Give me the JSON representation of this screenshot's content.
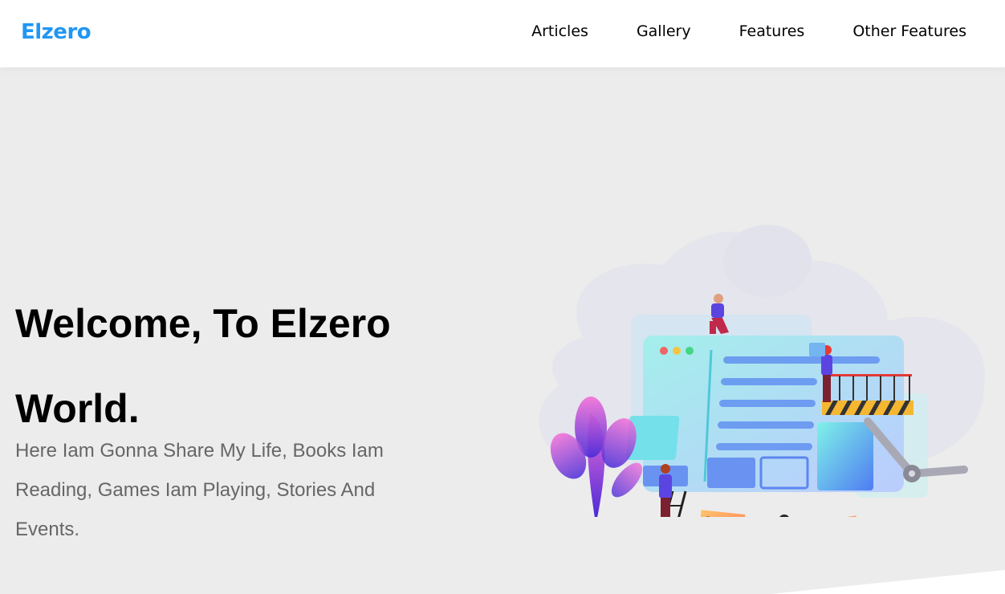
{
  "brand": {
    "name": "Elzero",
    "color": "#2196f3"
  },
  "nav": {
    "items": [
      "Articles",
      "Gallery",
      "Features",
      "Other Features"
    ]
  },
  "landing": {
    "title": "Welcome, To Elzero World.",
    "description": "Here Iam Gonna Share My Life, Books Iam Reading, Games Iam Playing, Stories And Events.",
    "illustration": "web-development-illustration"
  },
  "colors": {
    "background": "#ececec",
    "header": "#ffffff",
    "title": "#000000",
    "description": "#666666"
  }
}
